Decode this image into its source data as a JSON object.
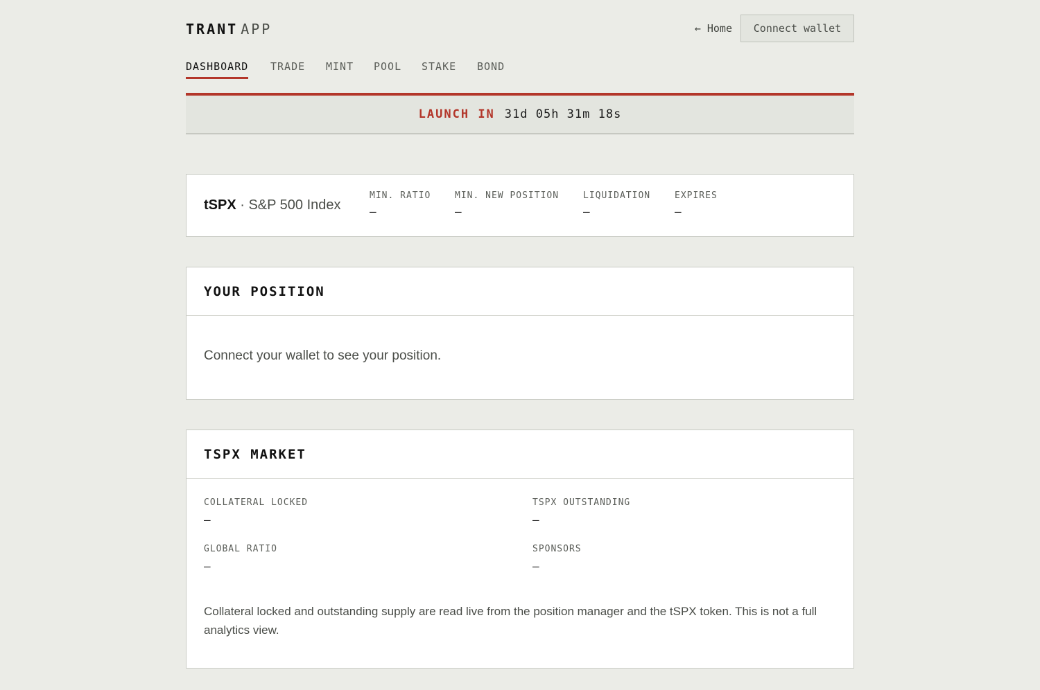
{
  "header": {
    "brand_bold": "TRANT",
    "brand_light": "APP",
    "home_link": "← Home",
    "connect_wallet": "Connect wallet"
  },
  "nav": {
    "items": [
      "DASHBOARD",
      "TRADE",
      "MINT",
      "POOL",
      "STAKE",
      "BOND"
    ],
    "active": "DASHBOARD"
  },
  "countdown": {
    "label": "LAUNCH IN",
    "value": "31d 05h 31m 18s"
  },
  "instrument": {
    "ticker": "tSPX",
    "separator": " · ",
    "name": "S&P 500 Index",
    "stats": [
      {
        "label": "MIN. RATIO",
        "value": "—"
      },
      {
        "label": "MIN. NEW POSITION",
        "value": "—"
      },
      {
        "label": "LIQUIDATION",
        "value": "—"
      },
      {
        "label": "EXPIRES",
        "value": "—"
      }
    ]
  },
  "position": {
    "title": "YOUR POSITION",
    "message": "Connect your wallet to see your position."
  },
  "market": {
    "title": "TSPX MARKET",
    "stats": [
      {
        "label": "COLLATERAL LOCKED",
        "value": "—"
      },
      {
        "label": "TSPX OUTSTANDING",
        "value": "—"
      },
      {
        "label": "GLOBAL RATIO",
        "value": "—"
      },
      {
        "label": "SPONSORS",
        "value": "—"
      }
    ],
    "note": "Collateral locked and outstanding supply are read live from the position manager and the tSPX token. This is not a full analytics view."
  },
  "colors": {
    "accent": "#b3362a",
    "background": "#ebece7",
    "card": "#ffffff"
  }
}
